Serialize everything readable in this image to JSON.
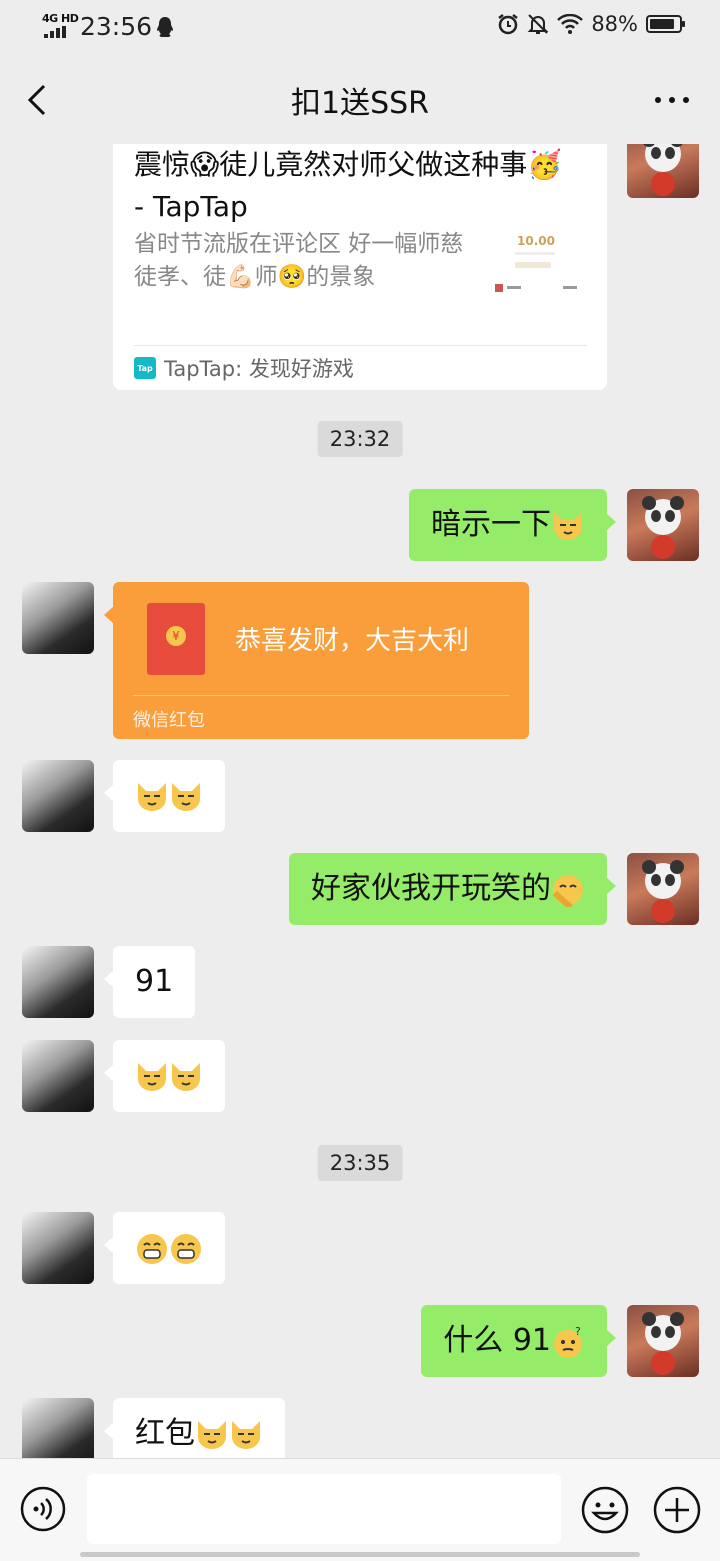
{
  "status_bar": {
    "network": "4G HD",
    "time": "23:56",
    "battery": "88%",
    "battery_level": 0.88
  },
  "nav": {
    "title": "扣1送SSR",
    "more_label": "···"
  },
  "link_card": {
    "title": "震惊😱徒儿竟然对师父做这种事🥳 - TapTap",
    "description": "省时节流版在评论区  好一幅师慈徒孝、徒💪🏻师🥺的景象",
    "thumb_value": "10.00",
    "source": "TapTap: 发现好游戏",
    "source_icon_text": "Tap"
  },
  "timestamps": [
    "23:32",
    "23:35"
  ],
  "messages": {
    "m1_text": "暗示一下",
    "red_packet": {
      "text": "恭喜发财，大吉大利",
      "label": "微信红包",
      "coin": "¥"
    },
    "m3_text": "好家伙我开玩笑的",
    "m4_text": "91",
    "m6_text": "什么 91",
    "m7_text": "红包"
  },
  "colors": {
    "background": "#ededed",
    "bubble_self": "#95ec69",
    "bubble_peer": "#ffffff",
    "red_packet": "#fa9d3b"
  }
}
